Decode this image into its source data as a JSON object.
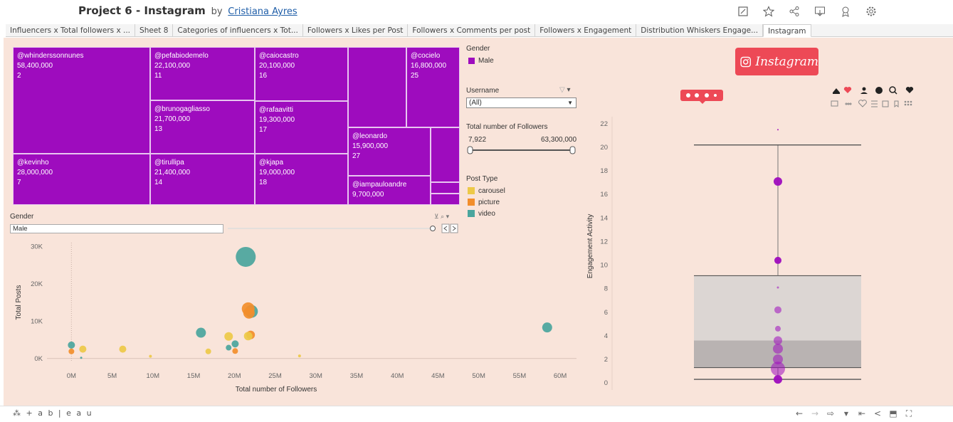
{
  "header": {
    "title": "Project 6 - Instagram",
    "by": "by",
    "author": "Cristiana Ayres"
  },
  "toolbar_icons": [
    "edit-icon",
    "star-icon",
    "share-icon",
    "download-icon",
    "ribbon-icon",
    "gear-icon"
  ],
  "tabs": [
    {
      "label": "Influencers x Total followers x ...",
      "active": false
    },
    {
      "label": "Sheet 8",
      "active": false
    },
    {
      "label": "Categories of influencers x Tot...",
      "active": false
    },
    {
      "label": "Followers x Likes per Post",
      "active": false
    },
    {
      "label": "Followers x Comments per post",
      "active": false
    },
    {
      "label": "Followers x Engagement",
      "active": false
    },
    {
      "label": "Distribution Whiskers Engage...",
      "active": false
    },
    {
      "label": "Instagram",
      "active": true
    }
  ],
  "treemap": {
    "color": "#9e0cbe",
    "cells": [
      {
        "name": "@whinderssonnunes",
        "followers": "58,400,000",
        "rank": "2"
      },
      {
        "name": "@pefabiodemelo",
        "followers": "22,100,000",
        "rank": "11"
      },
      {
        "name": "@caiocastro",
        "followers": "20,100,000",
        "rank": "16"
      },
      {
        "name": "@cocielo",
        "followers": "16,800,000",
        "rank": "25"
      },
      {
        "name": "@brunogagliasso",
        "followers": "21,700,000",
        "rank": "13"
      },
      {
        "name": "@rafaavitti",
        "followers": "19,300,000",
        "rank": "17"
      },
      {
        "name": "@leonardo",
        "followers": "15,900,000",
        "rank": "27"
      },
      {
        "name": "@kevinho",
        "followers": "28,000,000",
        "rank": "7"
      },
      {
        "name": "@tirullipa",
        "followers": "21,400,000",
        "rank": "14"
      },
      {
        "name": "@kjapa",
        "followers": "19,000,000",
        "rank": "18"
      },
      {
        "name": "@iampauloandre",
        "followers": "9,700,000",
        "rank": ""
      }
    ]
  },
  "filters": {
    "gender_title": "Gender",
    "gender_value": "Male",
    "gender_color": "#9e0cbe",
    "username_title": "Username",
    "username_value": "(All)",
    "followers_title": "Total number of Followers",
    "followers_min": "7,922",
    "followers_max": "63,300,000",
    "post_type_title": "Post Type",
    "post_types": [
      {
        "label": "carousel",
        "color": "#edc948"
      },
      {
        "label": "picture",
        "color": "#f28e2b"
      },
      {
        "label": "video",
        "color": "#4aa59d"
      }
    ],
    "gender_filter_title": "Gender",
    "gender_filter_value": "Male"
  },
  "scatter": {
    "type": "scatter",
    "xlabel": "Total number of Followers",
    "ylabel": "Total Posts",
    "x_ticks": [
      "0M",
      "5M",
      "10M",
      "15M",
      "20M",
      "25M",
      "30M",
      "35M",
      "40M",
      "45M",
      "50M",
      "55M",
      "60M"
    ],
    "y_ticks": [
      "0K",
      "10K",
      "20K",
      "30K"
    ],
    "xlim": [
      -3,
      62
    ],
    "ylim": [
      -1,
      31
    ],
    "points": [
      {
        "x": 21.4,
        "y": 27.2,
        "size": 14,
        "type": "video"
      },
      {
        "x": 22.1,
        "y": 12.6,
        "size": 9,
        "type": "video"
      },
      {
        "x": 21.7,
        "y": 13.3,
        "size": 9,
        "type": "picture"
      },
      {
        "x": 21.8,
        "y": 12.2,
        "size": 8,
        "type": "picture"
      },
      {
        "x": 22.0,
        "y": 6.3,
        "size": 6,
        "type": "picture"
      },
      {
        "x": 21.7,
        "y": 6.0,
        "size": 6,
        "type": "carousel"
      },
      {
        "x": 58.4,
        "y": 8.3,
        "size": 7,
        "type": "video"
      },
      {
        "x": 15.9,
        "y": 6.9,
        "size": 7,
        "type": "video"
      },
      {
        "x": 19.3,
        "y": 5.9,
        "size": 6,
        "type": "carousel"
      },
      {
        "x": 20.1,
        "y": 3.9,
        "size": 5,
        "type": "video"
      },
      {
        "x": 19.3,
        "y": 2.9,
        "size": 4,
        "type": "video"
      },
      {
        "x": 20.1,
        "y": 2.0,
        "size": 4,
        "type": "picture"
      },
      {
        "x": 16.8,
        "y": 1.9,
        "size": 4,
        "type": "carousel"
      },
      {
        "x": 0.0,
        "y": 3.6,
        "size": 5,
        "type": "video"
      },
      {
        "x": 0.0,
        "y": 1.9,
        "size": 4,
        "type": "picture"
      },
      {
        "x": 1.4,
        "y": 2.5,
        "size": 5,
        "type": "carousel"
      },
      {
        "x": 6.3,
        "y": 2.5,
        "size": 5,
        "type": "carousel"
      },
      {
        "x": 9.7,
        "y": 0.6,
        "size": 2,
        "type": "carousel"
      },
      {
        "x": 28.0,
        "y": 0.7,
        "size": 2,
        "type": "carousel"
      },
      {
        "x": 1.2,
        "y": 0.2,
        "size": 1.5,
        "type": "video"
      }
    ]
  },
  "boxplot": {
    "type": "box",
    "ylabel": "Engagement Activity",
    "y_ticks": [
      "0",
      "2",
      "4",
      "6",
      "8",
      "10",
      "12",
      "14",
      "16",
      "18",
      "20",
      "22"
    ],
    "ylim": [
      -0.6,
      22.6
    ],
    "whisker_low": 0.3,
    "q1": 1.3,
    "median": 3.6,
    "q3": 9.1,
    "whisker_high": 20.2,
    "points": [
      {
        "y": 21.5,
        "r": 1
      },
      {
        "y": 17.1,
        "r": 6
      },
      {
        "y": 10.4,
        "r": 5
      },
      {
        "y": 8.1,
        "r": 1.5
      },
      {
        "y": 6.2,
        "r": 5
      },
      {
        "y": 4.6,
        "r": 4
      },
      {
        "y": 3.6,
        "r": 6
      },
      {
        "y": 2.9,
        "r": 7
      },
      {
        "y": 2.0,
        "r": 7
      },
      {
        "y": 1.2,
        "r": 10
      },
      {
        "y": 0.3,
        "r": 6
      }
    ]
  },
  "instagram_badge": {
    "text": "Instagram",
    "color": "#ed4956"
  },
  "footer": {
    "logo": "+ a b | e a u"
  }
}
